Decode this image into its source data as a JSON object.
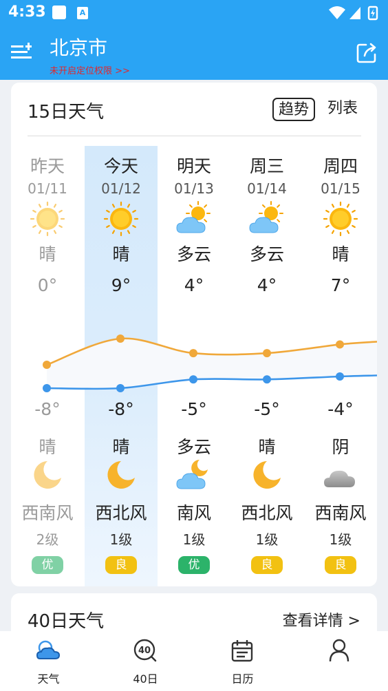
{
  "status_bar": {
    "time": "4:33",
    "notif_label": "A"
  },
  "header": {
    "city": "北京市",
    "location_hint": "未开启定位权限 >>"
  },
  "forecast15": {
    "title": "15日天气",
    "tabs": {
      "trend": "趋势",
      "list": "列表"
    },
    "days": [
      {
        "label": "昨天",
        "date": "01/11",
        "day_icon": "sun-icon",
        "day_cond": "晴",
        "high": "0°",
        "low": "-8°",
        "night_cond": "晴",
        "night_icon": "moon-icon",
        "wind_dir": "西南风",
        "wind_level": "2级",
        "aqi": "优",
        "aqi_color": "#2cb36a"
      },
      {
        "label": "今天",
        "date": "01/12",
        "day_icon": "sun-icon",
        "day_cond": "晴",
        "high": "9°",
        "low": "-8°",
        "night_cond": "晴",
        "night_icon": "moon-icon",
        "wind_dir": "西北风",
        "wind_level": "1级",
        "aqi": "良",
        "aqi_color": "#f2c112"
      },
      {
        "label": "明天",
        "date": "01/13",
        "day_icon": "partly-cloudy-icon",
        "day_cond": "多云",
        "high": "4°",
        "low": "-5°",
        "night_cond": "多云",
        "night_icon": "cloudy-night-icon",
        "wind_dir": "南风",
        "wind_level": "1级",
        "aqi": "优",
        "aqi_color": "#2cb36a"
      },
      {
        "label": "周三",
        "date": "01/14",
        "day_icon": "partly-cloudy-icon",
        "day_cond": "多云",
        "high": "4°",
        "low": "-5°",
        "night_cond": "晴",
        "night_icon": "moon-icon",
        "wind_dir": "西北风",
        "wind_level": "1级",
        "aqi": "良",
        "aqi_color": "#f2c112"
      },
      {
        "label": "周四",
        "date": "01/15",
        "day_icon": "sun-icon",
        "day_cond": "晴",
        "high": "7°",
        "low": "-4°",
        "night_cond": "阴",
        "night_icon": "overcast-icon",
        "wind_dir": "西南风",
        "wind_level": "1级",
        "aqi": "良",
        "aqi_color": "#f2c112"
      }
    ],
    "high_temps": [
      0,
      9,
      4,
      4,
      7
    ],
    "low_temps": [
      -8,
      -8,
      -5,
      -5,
      -4
    ],
    "colors": {
      "high_line": "#f0a83a",
      "low_line": "#3d96ea"
    }
  },
  "forecast40": {
    "title": "40日天气",
    "detail_link": "查看详情 >"
  },
  "bottom_nav": [
    {
      "label": "天气",
      "icon": "weather-cloud-icon"
    },
    {
      "label": "40日",
      "icon": "forty-day-icon"
    },
    {
      "label": "日历",
      "icon": "calendar-icon"
    },
    {
      "label": "",
      "icon": "profile-icon"
    }
  ]
}
